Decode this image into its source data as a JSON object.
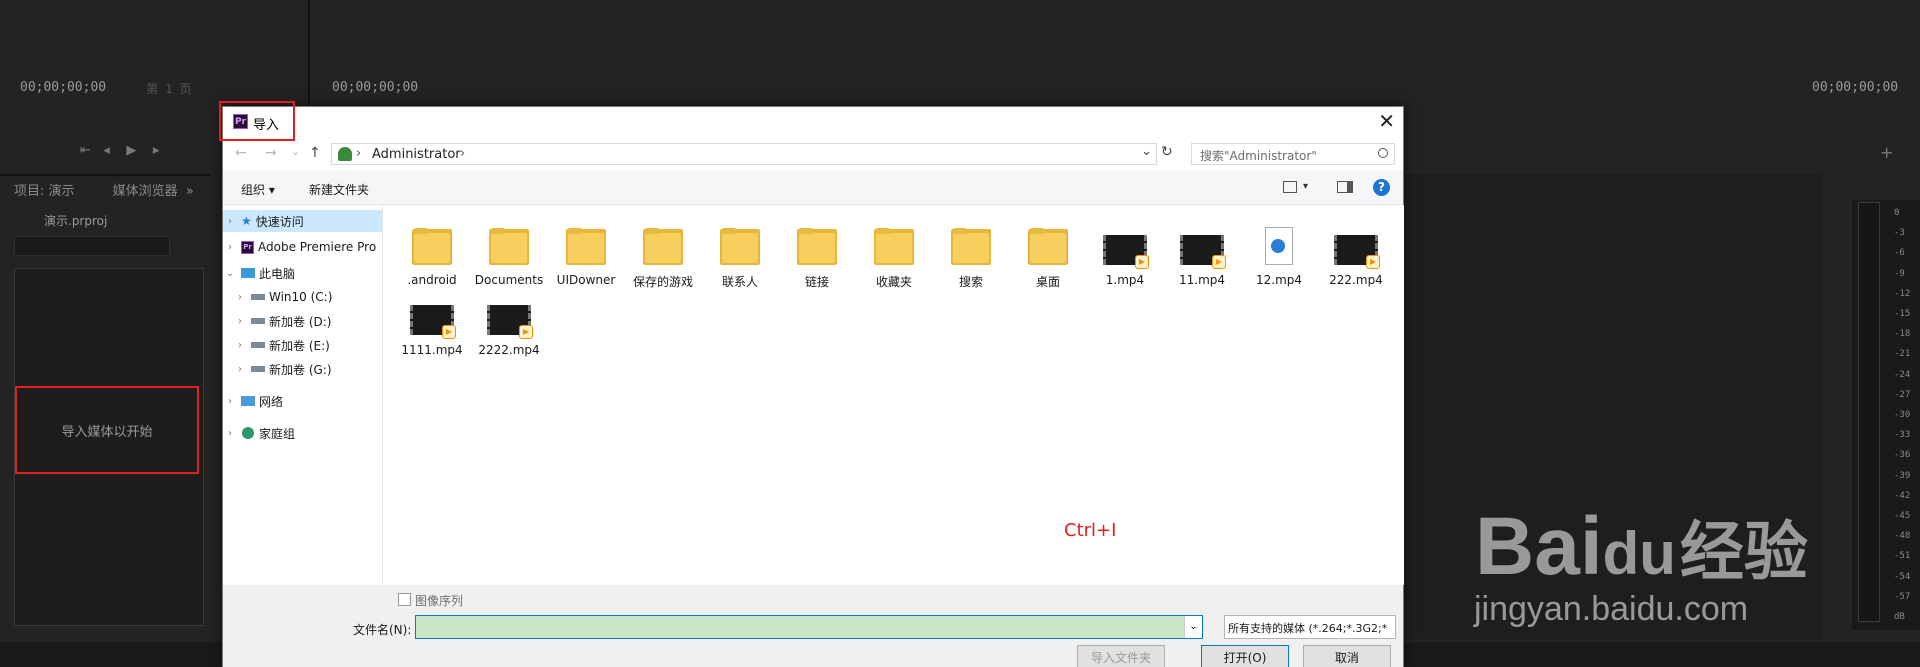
{
  "premiere": {
    "source_timecode": "00;00;00;00",
    "source_page": "第 1 页",
    "program_timecode_left": "00;00;00;00",
    "program_timecode_right": "00;00;00;00",
    "project_tab": "项目: 演示",
    "media_browser_tab": "媒体浏览器",
    "tab_more": "»",
    "project_file": "演示.prproj",
    "import_hint": "导入媒体以开始",
    "plus_label": "+",
    "meter_labels": [
      "0",
      "-3",
      "-6",
      "-9",
      "-12",
      "-15",
      "-18",
      "-21",
      "-24",
      "-27",
      "-30",
      "-33",
      "-36",
      "-39",
      "-42",
      "-45",
      "-48",
      "-51",
      "-54",
      "-57",
      "dB"
    ]
  },
  "watermark": {
    "brand": "Bai",
    "brand_du": "du",
    "brand_cn": "经验",
    "url": "jingyan.baidu.com"
  },
  "dialog": {
    "title": "导入",
    "app_icon_label": "Pr",
    "close_glyph": "✕",
    "nav": {
      "back": "←",
      "forward": "→",
      "dropdown": "⌄",
      "up": "↑"
    },
    "address": {
      "separator": "›",
      "path": "Administrator",
      "trailing_sep": "›",
      "dropdown": "⌄",
      "refresh": "↻"
    },
    "search_placeholder": "搜索\"Administrator\"",
    "toolbar": {
      "organize": "组织 ▾",
      "new_folder": "新建文件夹",
      "help": "?"
    },
    "nav_pane": [
      {
        "label": "快速访问",
        "chev": "›",
        "icon": "star-icon"
      },
      {
        "label": "Adobe Premiere Pro",
        "chev": "›",
        "icon": "premiere-icon"
      },
      {
        "label": "此电脑",
        "chev": "⌄",
        "icon": "pc-icon"
      },
      {
        "label": "Win10 (C:)",
        "chev": "›",
        "icon": "drive-icon"
      },
      {
        "label": "新加卷 (D:)",
        "chev": "›",
        "icon": "drive-icon"
      },
      {
        "label": "新加卷 (E:)",
        "chev": "›",
        "icon": "drive-icon"
      },
      {
        "label": "新加卷 (G:)",
        "chev": "›",
        "icon": "drive-icon"
      },
      {
        "label": "网络",
        "chev": "›",
        "icon": "network-icon"
      },
      {
        "label": "家庭组",
        "chev": "›",
        "icon": "homegroup-icon"
      }
    ],
    "files": [
      {
        "name": ".android",
        "kind": "folder"
      },
      {
        "name": "Documents",
        "kind": "folder"
      },
      {
        "name": "UIDowner",
        "kind": "folder"
      },
      {
        "name": "保存的游戏",
        "kind": "folder"
      },
      {
        "name": "联系人",
        "kind": "folder"
      },
      {
        "name": "链接",
        "kind": "folder"
      },
      {
        "name": "收藏夹",
        "kind": "folder"
      },
      {
        "name": "搜索",
        "kind": "folder"
      },
      {
        "name": "桌面",
        "kind": "folder"
      },
      {
        "name": "1.mp4",
        "kind": "video"
      },
      {
        "name": "11.mp4",
        "kind": "video"
      },
      {
        "name": "12.mp4",
        "kind": "doc"
      },
      {
        "name": "222.mp4",
        "kind": "video"
      },
      {
        "name": "1111.mp4",
        "kind": "video"
      },
      {
        "name": "2222.mp4",
        "kind": "video"
      }
    ],
    "shortcut_hint": "Ctrl+I",
    "image_sequence_label": "图像序列",
    "filename_label": "文件名(N):",
    "filename_value": "",
    "filetype_value": "所有支持的媒体 (*.264;*.3G2;*",
    "import_folder_button": "导入文件夹",
    "open_button": "打开(O)",
    "cancel_button": "取消"
  }
}
